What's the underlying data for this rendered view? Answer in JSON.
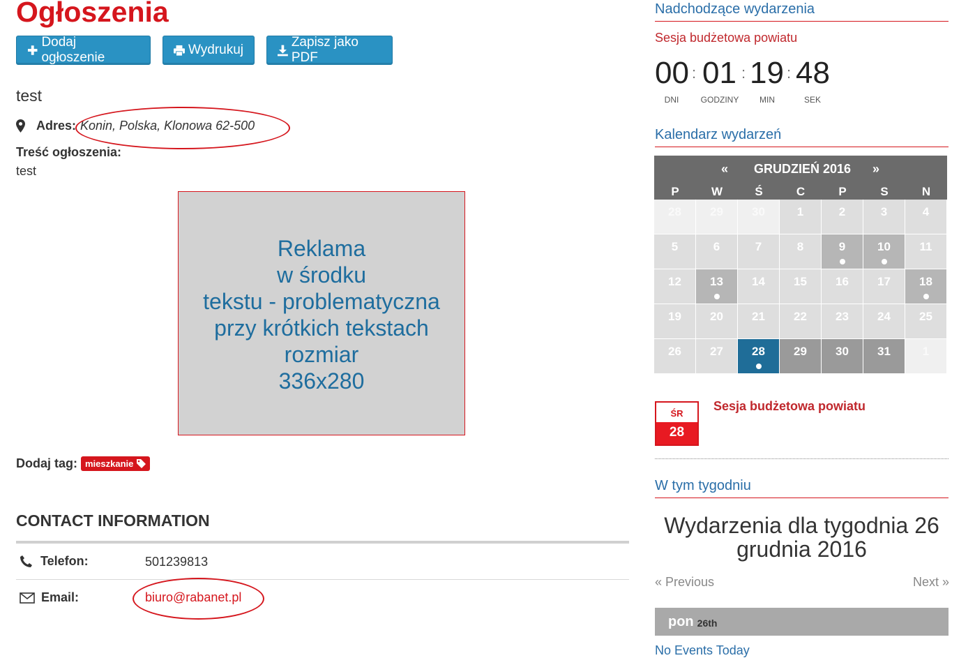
{
  "page": {
    "title": "Ogłoszenia",
    "buttons": {
      "add": "Dodaj ogłoszenie",
      "print": "Wydrukuj",
      "pdf": "Zapisz jako PDF"
    }
  },
  "listing": {
    "title": "test",
    "address_label": "Adres:",
    "address_value": "Konin, Polska, Klonowa 62-500",
    "content_label": "Treść ogłoszenia:",
    "content_text": "test",
    "ad_placeholder": {
      "lines": [
        "Reklama",
        "w środku",
        "tekstu - problematyczna",
        "przy krótkich tekstach",
        "rozmiar",
        "336x280"
      ]
    },
    "tag_label": "Dodaj tag:",
    "tag": "mieszkanie"
  },
  "contact": {
    "title": "CONTACT INFORMATION",
    "phone_label": "Telefon:",
    "phone_value": "501239813",
    "email_label": "Email:",
    "email_value": "biuro@rabanet.pl"
  },
  "upcoming": {
    "title": "Nadchodzące wydarzenia",
    "event": "Sesja budżetowa powiatu",
    "countdown": {
      "days": "00",
      "hours": "01",
      "minutes": "19",
      "seconds": "48",
      "days_label": "DNI",
      "hours_label": "GODZINY",
      "minutes_label": "MIN",
      "seconds_label": "SEK"
    }
  },
  "calendar": {
    "title": "Kalendarz wydarzeń",
    "prev": "«",
    "next": "»",
    "month": "GRUDZIEŃ 2016",
    "weekdays": [
      "P",
      "W",
      "Ś",
      "C",
      "P",
      "S",
      "N"
    ],
    "days": [
      {
        "d": "28",
        "t": "other"
      },
      {
        "d": "29",
        "t": "other"
      },
      {
        "d": "30",
        "t": "other"
      },
      {
        "d": "1",
        "t": "norm"
      },
      {
        "d": "2",
        "t": "norm"
      },
      {
        "d": "3",
        "t": "norm"
      },
      {
        "d": "4",
        "t": "norm"
      },
      {
        "d": "5",
        "t": "norm"
      },
      {
        "d": "6",
        "t": "norm"
      },
      {
        "d": "7",
        "t": "norm"
      },
      {
        "d": "8",
        "t": "norm"
      },
      {
        "d": "9",
        "t": "evt",
        "dot": true
      },
      {
        "d": "10",
        "t": "evt",
        "dot": true
      },
      {
        "d": "11",
        "t": "norm"
      },
      {
        "d": "12",
        "t": "norm"
      },
      {
        "d": "13",
        "t": "evt",
        "dot": true
      },
      {
        "d": "14",
        "t": "norm"
      },
      {
        "d": "15",
        "t": "norm"
      },
      {
        "d": "16",
        "t": "norm"
      },
      {
        "d": "17",
        "t": "norm"
      },
      {
        "d": "18",
        "t": "evt",
        "dot": true
      },
      {
        "d": "19",
        "t": "norm"
      },
      {
        "d": "20",
        "t": "norm"
      },
      {
        "d": "21",
        "t": "norm"
      },
      {
        "d": "22",
        "t": "norm"
      },
      {
        "d": "23",
        "t": "norm"
      },
      {
        "d": "24",
        "t": "norm"
      },
      {
        "d": "25",
        "t": "norm"
      },
      {
        "d": "26",
        "t": "norm"
      },
      {
        "d": "27",
        "t": "norm"
      },
      {
        "d": "28",
        "t": "today",
        "dot": true
      },
      {
        "d": "29",
        "t": "dark"
      },
      {
        "d": "30",
        "t": "dark"
      },
      {
        "d": "31",
        "t": "dark"
      },
      {
        "d": "1",
        "t": "other"
      }
    ],
    "selected_event": {
      "dow": "ŚR",
      "day": "28",
      "title": "Sesja budżetowa powiatu"
    }
  },
  "week": {
    "title": "W tym tygodniu",
    "heading": "Wydarzenia dla tygodnia 26 grudnia 2016",
    "prev": "« Previous",
    "next": "Next »",
    "day_name": "pon",
    "day_num": "26th",
    "no_events": "No Events Today"
  },
  "colors": {
    "brand_red": "#d5161d",
    "button_blue": "#2a92c3",
    "link_blue": "#2a6ea8",
    "today_blue": "#1f6d98"
  }
}
